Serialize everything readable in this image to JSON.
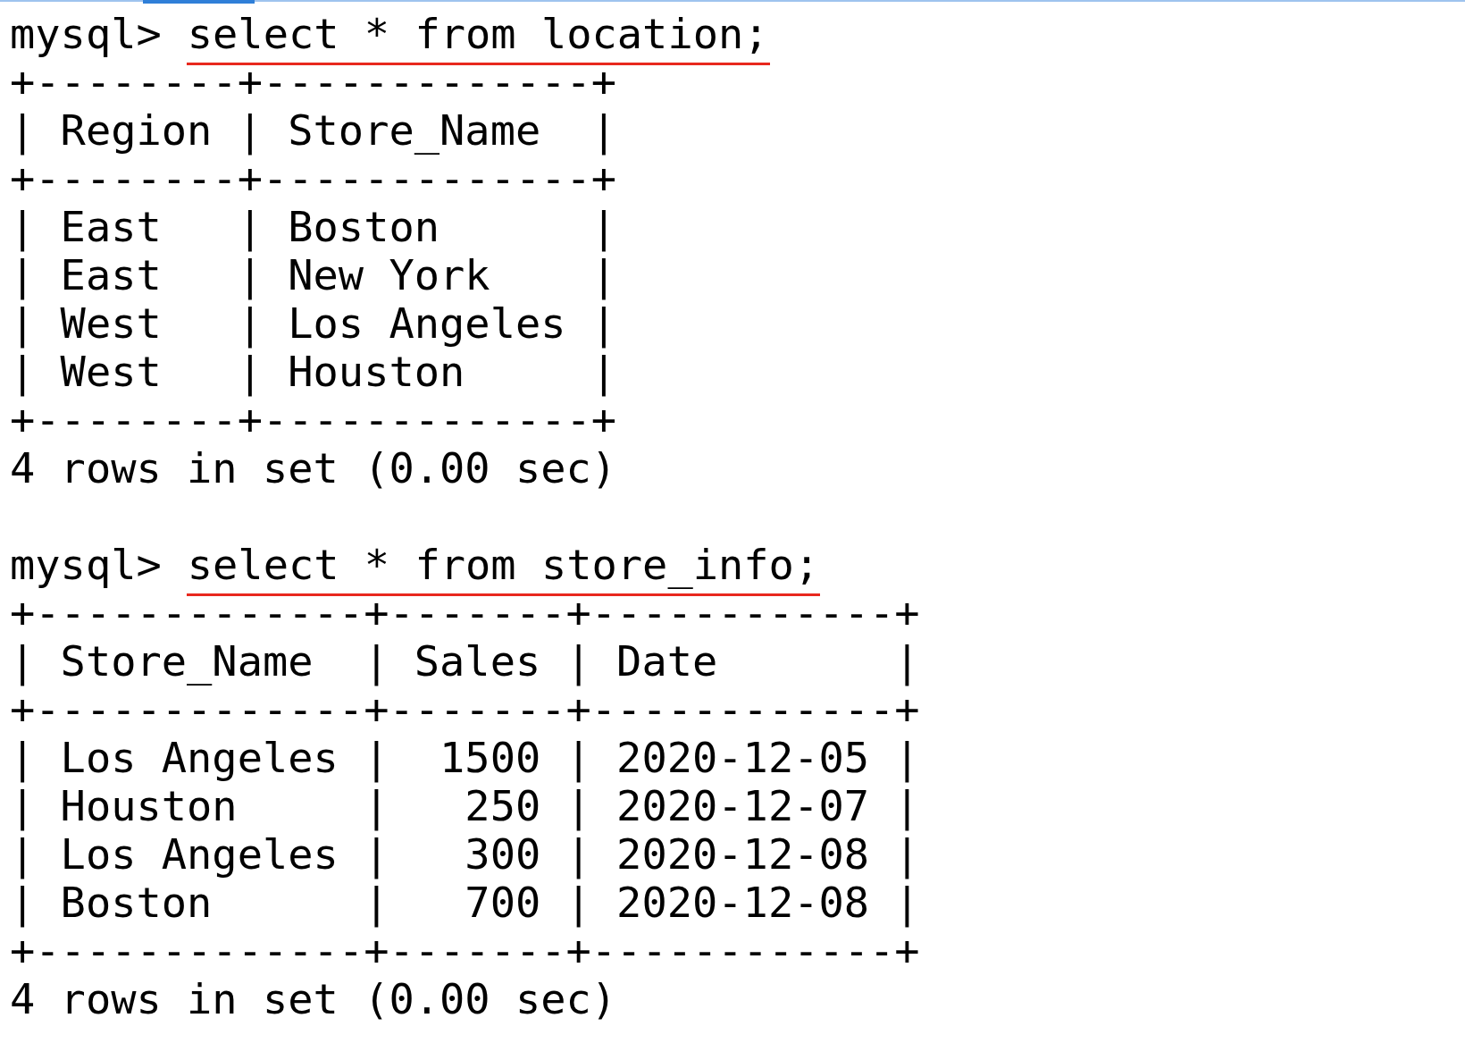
{
  "terminal": {
    "lines": [
      {
        "kind": "command",
        "prompt": "mysql>",
        "text": "select * from location;",
        "underlined": true
      },
      {
        "kind": "output",
        "text": "+--------+-------------+"
      },
      {
        "kind": "output",
        "text": "| Region | Store_Name  |"
      },
      {
        "kind": "output",
        "text": "+--------+-------------+"
      },
      {
        "kind": "output",
        "text": "| East   | Boston      |"
      },
      {
        "kind": "output",
        "text": "| East   | New York    |"
      },
      {
        "kind": "output",
        "text": "| West   | Los Angeles |"
      },
      {
        "kind": "output",
        "text": "| West   | Houston     |"
      },
      {
        "kind": "output",
        "text": "+--------+-------------+"
      },
      {
        "kind": "output",
        "text": "4 rows in set (0.00 sec)"
      },
      {
        "kind": "blank"
      },
      {
        "kind": "command",
        "prompt": "mysql>",
        "text": "select * from store_info;",
        "underlined": true
      },
      {
        "kind": "output",
        "text": "+-------------+-------+------------+"
      },
      {
        "kind": "output",
        "text": "| Store_Name  | Sales | Date       |"
      },
      {
        "kind": "output",
        "text": "+-------------+-------+------------+"
      },
      {
        "kind": "output",
        "text": "| Los Angeles |  1500 | 2020-12-05 |"
      },
      {
        "kind": "output",
        "text": "| Houston     |   250 | 2020-12-07 |"
      },
      {
        "kind": "output",
        "text": "| Los Angeles |   300 | 2020-12-08 |"
      },
      {
        "kind": "output",
        "text": "| Boston      |   700 | 2020-12-08 |"
      },
      {
        "kind": "output",
        "text": "+-------------+-------+------------+"
      },
      {
        "kind": "output",
        "text": "4 rows in set (0.00 sec)"
      }
    ]
  }
}
